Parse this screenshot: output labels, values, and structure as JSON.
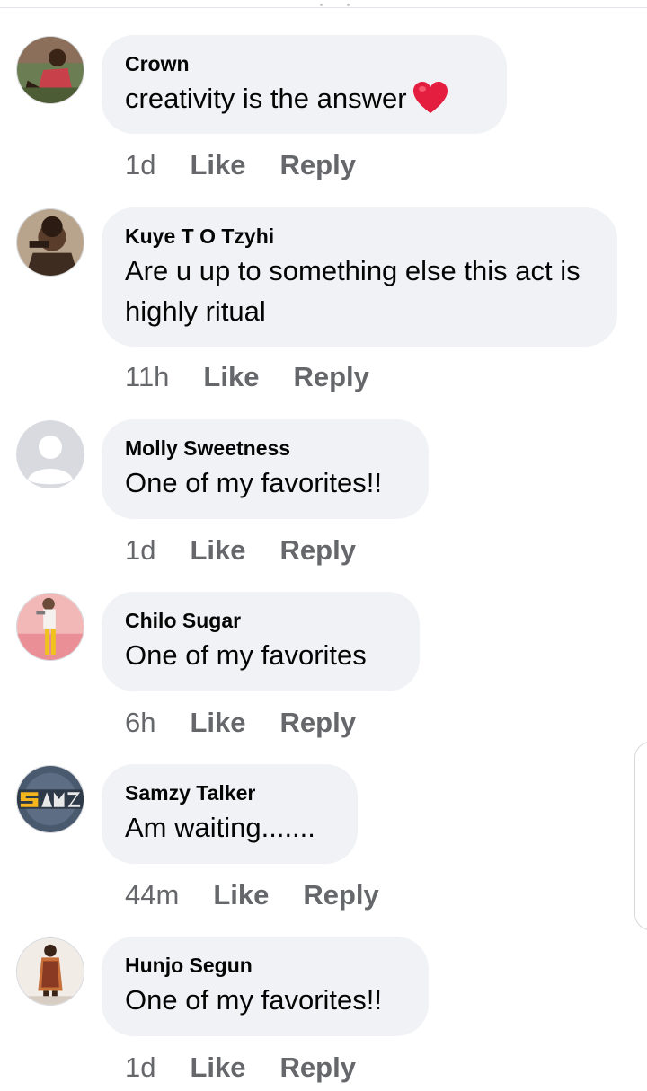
{
  "comments": [
    {
      "author": "Crown",
      "text": "creativity is the answer",
      "reaction_icon": "red-heart-icon",
      "time": "1d",
      "like_label": "Like",
      "reply_label": "Reply"
    },
    {
      "author": "Kuye T O Tzyhi",
      "text": "Are u up to something else this act is highly ritual",
      "time": "11h",
      "like_label": "Like",
      "reply_label": "Reply"
    },
    {
      "author": "Molly Sweetness",
      "text": "One of my favorites!!",
      "time": "1d",
      "like_label": "Like",
      "reply_label": "Reply"
    },
    {
      "author": "Chilo Sugar",
      "text": "One of my favorites",
      "time": "6h",
      "like_label": "Like",
      "reply_label": "Reply"
    },
    {
      "author": "Samzy Talker",
      "text": "Am waiting.......",
      "time": "44m",
      "like_label": "Like",
      "reply_label": "Reply"
    },
    {
      "author": "Hunjo Segun",
      "text": "One of my favorites!!",
      "time": "1d",
      "like_label": "Like",
      "reply_label": "Reply"
    }
  ],
  "colors": {
    "bubble_bg": "#f0f2f5",
    "action_text": "#65676b",
    "heart": "#e41e3f"
  }
}
